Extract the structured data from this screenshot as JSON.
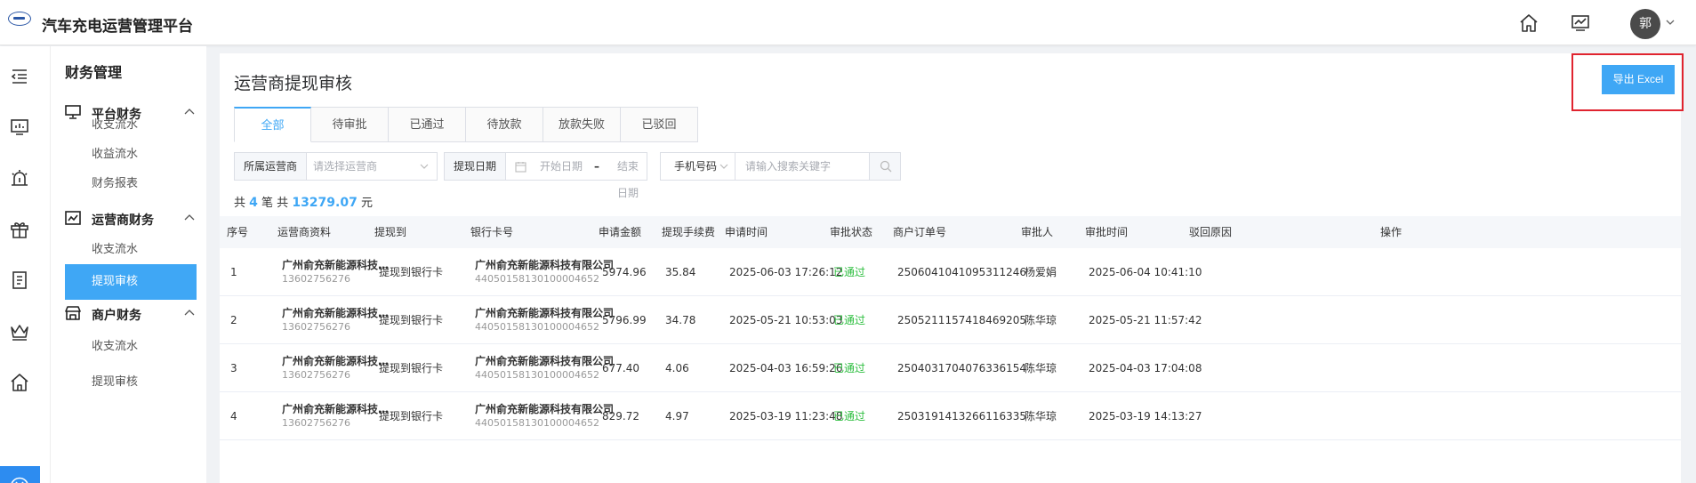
{
  "app": {
    "title": "汽车充电运营管理平台"
  },
  "header": {
    "avatar_text": "郭"
  },
  "menu": {
    "title": "财务管理",
    "groups": [
      {
        "label": "平台财务",
        "items": [
          "收支流水",
          "收益流水",
          "财务报表"
        ]
      },
      {
        "label": "运营商财务",
        "items": [
          "收支流水",
          "提现审核"
        ]
      },
      {
        "label": "商户财务",
        "items": [
          "收支流水",
          "提现审核"
        ]
      }
    ],
    "active_item": "提现审核"
  },
  "page": {
    "title": "运营商提现审核",
    "export_label": "导出 Excel",
    "tabs": [
      "全部",
      "待审批",
      "已通过",
      "待放款",
      "放款失败",
      "已驳回"
    ],
    "active_tab": "全部"
  },
  "filters": {
    "operator_label": "所属运营商",
    "operator_placeholder": "请选择运营商",
    "date_label": "提现日期",
    "start_placeholder": "开始日期",
    "date_sep": "–",
    "end_placeholder": "结束日期",
    "phone_label": "手机号码",
    "keyword_placeholder": "请输入搜索关键字"
  },
  "summary": {
    "prefix": "共",
    "count": "4",
    "mid": "笔 共",
    "amount": "13279.07",
    "suffix": "元"
  },
  "table": {
    "columns": [
      "序号",
      "运营商资料",
      "提现到",
      "银行卡号",
      "申请金额",
      "提现手续费",
      "申请时间",
      "审批状态",
      "商户订单号",
      "审批人",
      "审批时间",
      "驳回原因",
      "操作"
    ],
    "rows": [
      {
        "idx": "1",
        "op_name": "广州俞充新能源科技…",
        "op_phone": "13602756276",
        "to": "提现到银行卡",
        "bank_name": "广州俞充新能源科技有限公司",
        "bank_no": "44050158130100004652",
        "amount": "5974.96",
        "fee": "35.84",
        "apply_time": "2025-06-03 17:26:12",
        "status": "已通过",
        "order_no": "2506041041095311246",
        "approver": "杨爱娟",
        "approve_time": "2025-06-04 10:41:10",
        "reason": "",
        "op": ""
      },
      {
        "idx": "2",
        "op_name": "广州俞充新能源科技…",
        "op_phone": "13602756276",
        "to": "提现到银行卡",
        "bank_name": "广州俞充新能源科技有限公司",
        "bank_no": "44050158130100004652",
        "amount": "5796.99",
        "fee": "34.78",
        "apply_time": "2025-05-21 10:53:03",
        "status": "已通过",
        "order_no": "2505211157418469205",
        "approver": "陈华琼",
        "approve_time": "2025-05-21 11:57:42",
        "reason": "",
        "op": ""
      },
      {
        "idx": "3",
        "op_name": "广州俞充新能源科技…",
        "op_phone": "13602756276",
        "to": "提现到银行卡",
        "bank_name": "广州俞充新能源科技有限公司",
        "bank_no": "44050158130100004652",
        "amount": "677.40",
        "fee": "4.06",
        "apply_time": "2025-04-03 16:59:26",
        "status": "已通过",
        "order_no": "2504031704076336154",
        "approver": "陈华琼",
        "approve_time": "2025-04-03 17:04:08",
        "reason": "",
        "op": ""
      },
      {
        "idx": "4",
        "op_name": "广州俞充新能源科技…",
        "op_phone": "13602756276",
        "to": "提现到银行卡",
        "bank_name": "广州俞充新能源科技有限公司",
        "bank_no": "44050158130100004652",
        "amount": "829.72",
        "fee": "4.97",
        "apply_time": "2025-03-19 11:23:48",
        "status": "已通过",
        "order_no": "2503191413266116335",
        "approver": "陈华琼",
        "approve_time": "2025-03-19 14:13:27",
        "reason": "",
        "op": ""
      }
    ]
  },
  "colors": {
    "accent": "#3fa7f5",
    "rail_active": "#2d8cf0",
    "status_ok": "#2dbe3f",
    "highlight_frame": "#e0242f"
  },
  "icons": {
    "header": [
      "home-icon",
      "monitor-chart-icon",
      "chevron-down-icon"
    ],
    "rail": [
      "collapse-menu-icon",
      "dashboard-icon",
      "alarm-icon",
      "gift-icon",
      "list-icon",
      "crown-icon",
      "house-icon",
      "yuan-icon"
    ]
  }
}
